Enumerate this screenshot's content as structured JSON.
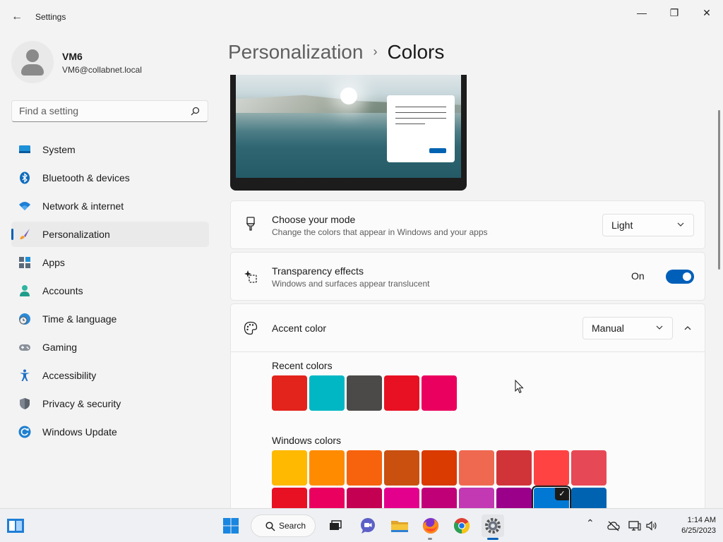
{
  "window": {
    "title": "Settings",
    "back_glyph": "←",
    "minimize_glyph": "—",
    "restore_glyph": "❐",
    "close_glyph": "✕"
  },
  "profile": {
    "name": "VM6",
    "email": "VM6@collabnet.local"
  },
  "search": {
    "placeholder": "Find a setting"
  },
  "nav": [
    {
      "label": "System",
      "icon": "system-icon"
    },
    {
      "label": "Bluetooth & devices",
      "icon": "bluetooth-icon"
    },
    {
      "label": "Network & internet",
      "icon": "wifi-icon"
    },
    {
      "label": "Personalization",
      "icon": "paintbrush-icon",
      "active": true
    },
    {
      "label": "Apps",
      "icon": "apps-icon"
    },
    {
      "label": "Accounts",
      "icon": "accounts-icon"
    },
    {
      "label": "Time & language",
      "icon": "clock-globe-icon"
    },
    {
      "label": "Gaming",
      "icon": "gamepad-icon"
    },
    {
      "label": "Accessibility",
      "icon": "accessibility-icon"
    },
    {
      "label": "Privacy & security",
      "icon": "shield-icon"
    },
    {
      "label": "Windows Update",
      "icon": "update-icon"
    }
  ],
  "breadcrumb": {
    "parent": "Personalization",
    "separator": "›",
    "current": "Colors"
  },
  "mode": {
    "title": "Choose your mode",
    "description": "Change the colors that appear in Windows and your apps",
    "value": "Light"
  },
  "transparency": {
    "title": "Transparency effects",
    "description": "Windows and surfaces appear translucent",
    "state_label": "On",
    "enabled": true
  },
  "accent": {
    "title": "Accent color",
    "value": "Manual",
    "recent_label": "Recent colors",
    "recent_colors": [
      "#e3241c",
      "#00b7c3",
      "#4c4a48",
      "#e81123",
      "#ea005e"
    ],
    "windows_label": "Windows colors",
    "windows_colors": [
      [
        "#ffb900",
        "#ff8c00",
        "#f7630c",
        "#ca5010",
        "#da3b01",
        "#ef6950",
        "#d13438",
        "#ff4343",
        "#e74856"
      ],
      [
        "#e81123",
        "#ea005e",
        "#c30052",
        "#e3008c",
        "#bf0077",
        "#c239b3",
        "#9a0089",
        "#0078d4",
        "#0063b1"
      ]
    ],
    "selected_color": "#0078d4",
    "check_glyph": "✓"
  },
  "taskbar": {
    "search_label": "Search",
    "time": "1:14 AM",
    "date": "6/25/2023",
    "tray_chevron_glyph": "⌃"
  }
}
